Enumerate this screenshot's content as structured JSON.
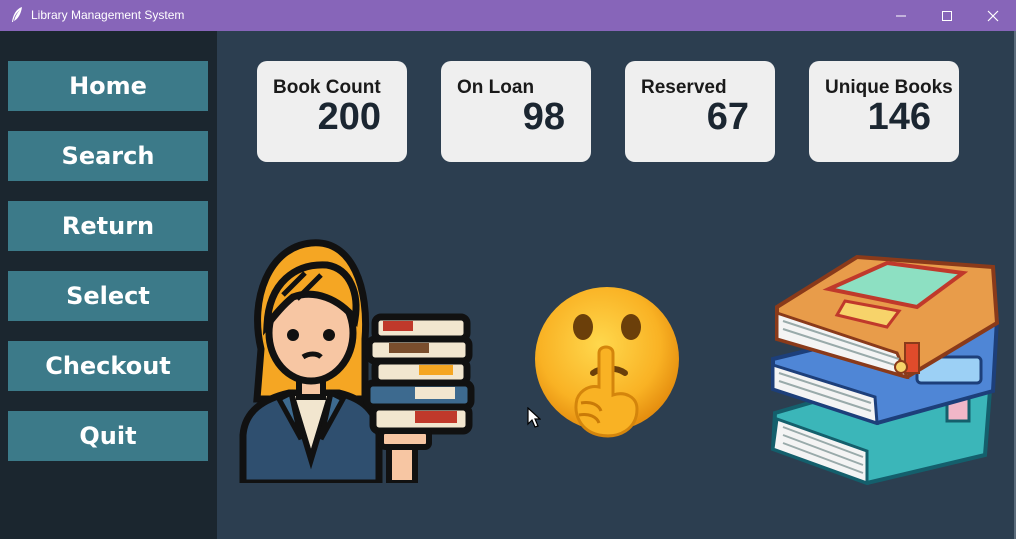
{
  "window": {
    "title": "Library Management System",
    "icon": "feather-icon",
    "titlebar_color": "#8765b9"
  },
  "sidebar": {
    "items": [
      {
        "label": "Home",
        "icon": null
      },
      {
        "label": "Search",
        "icon": null
      },
      {
        "label": "Return",
        "icon": null
      },
      {
        "label": "Select",
        "icon": null
      },
      {
        "label": "Checkout",
        "icon": null
      },
      {
        "label": "Quit",
        "icon": null
      }
    ],
    "button_color": "#3c7a89"
  },
  "stats": [
    {
      "label": "Book Count",
      "value": "200"
    },
    {
      "label": "On Loan",
      "value": "98"
    },
    {
      "label": "Reserved",
      "value": "67"
    },
    {
      "label": "Unique Books",
      "value": "146"
    }
  ],
  "illustrations": [
    "librarian-with-books-icon",
    "shushing-face-emoji",
    "stack-of-books-icon"
  ],
  "colors": {
    "background": "#2c3e50",
    "sidebar": "#1b262f",
    "card": "#efefef"
  }
}
